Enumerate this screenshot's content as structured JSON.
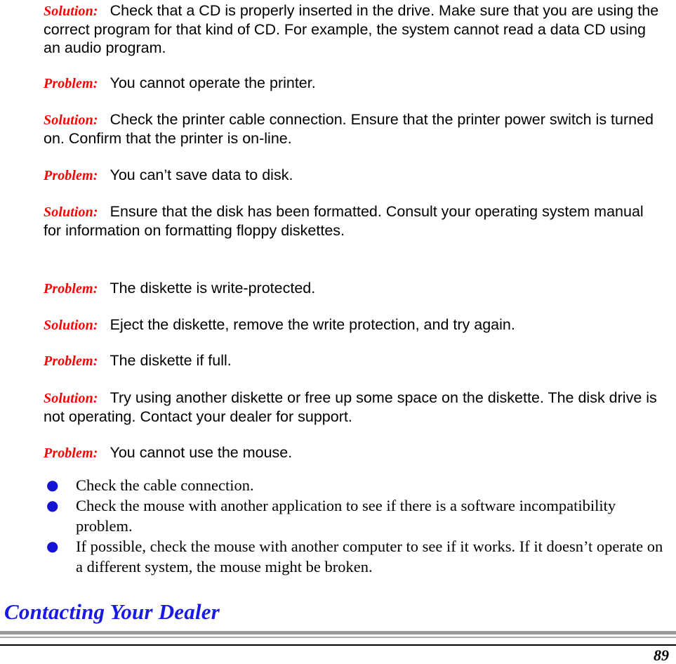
{
  "document": {
    "page_number": "89",
    "label_color": "#ff0000",
    "heading_color": "#1a1ae6",
    "bullet_color": "#1414d2",
    "body_color": "#000000"
  },
  "entries": [
    {
      "label": "Solution:",
      "text": "Check that a CD is properly inserted in the drive.  Make sure that you are using the correct program for that kind of CD.  For example, the system cannot read a data CD using an audio program."
    },
    {
      "label": "Problem:",
      "text": "You cannot operate the printer."
    },
    {
      "label": "Solution:",
      "text": "Check the printer cable connection.  Ensure that the printer power switch is turned on.  Confirm that the printer is on-line."
    },
    {
      "label": "Problem:",
      "text": "You can’t save data to disk."
    },
    {
      "label": "Solution:",
      "text": "Ensure that the disk has been formatted. Consult your operating system manual for information on formatting floppy diskettes."
    },
    {
      "label": "Problem:",
      "text": "The diskette is write-protected."
    },
    {
      "label": "Solution:",
      "text": "Eject the diskette, remove the write protection, and try again."
    },
    {
      "label": "Problem:",
      "text": "The diskette if full."
    },
    {
      "label": "Solution:",
      "text": "Try using another diskette or free up some space on the diskette.  The disk drive is not operating.  Contact your dealer for support."
    },
    {
      "label": "Problem:",
      "text": "You cannot use the mouse."
    }
  ],
  "bullets": {
    "marker": "●",
    "items": [
      "Check the cable connection.",
      "Check the mouse with another application to see if there is a software incompatibility problem.",
      "If possible, check the mouse with another computer to see if it works.  If it doesn’t operate on a different system, the mouse might be broken."
    ]
  },
  "heading": {
    "text": "Contacting Your Dealer"
  }
}
